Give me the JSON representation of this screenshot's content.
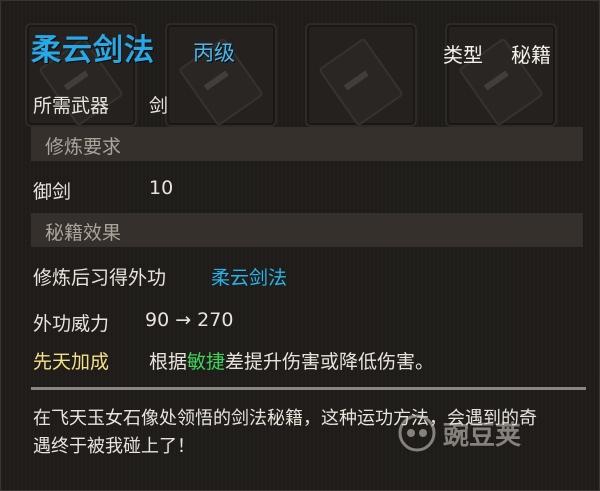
{
  "header": {
    "title": "柔云剑法",
    "grade": "丙级",
    "type_label": "类型",
    "type_value": "秘籍"
  },
  "weapon": {
    "label": "所需武器",
    "value": "剑"
  },
  "sections": {
    "training": "修炼要求",
    "effects": "秘籍效果"
  },
  "requirement": {
    "label": "御剑",
    "value": "10"
  },
  "learn": {
    "label": "修炼后习得外功",
    "value": "柔云剑法"
  },
  "power": {
    "label": "外功威力",
    "value": "90 → 270"
  },
  "innate": {
    "label": "先天加成",
    "text_pre": "根据",
    "stat": "敏捷",
    "text_post": "差提升伤害或降低伤害。"
  },
  "description": "在飞天玉女石像处领悟的剑法秘籍，这种运功方法，会遇到的奇遇终于被我碰上了！",
  "watermark": "豌豆荚",
  "colors": {
    "title": "#28a8e6",
    "grade": "#4ab8f0",
    "skill_link": "#28b4e8",
    "innate_label": "#f5e08a",
    "stat_highlight": "#3fd35c"
  }
}
